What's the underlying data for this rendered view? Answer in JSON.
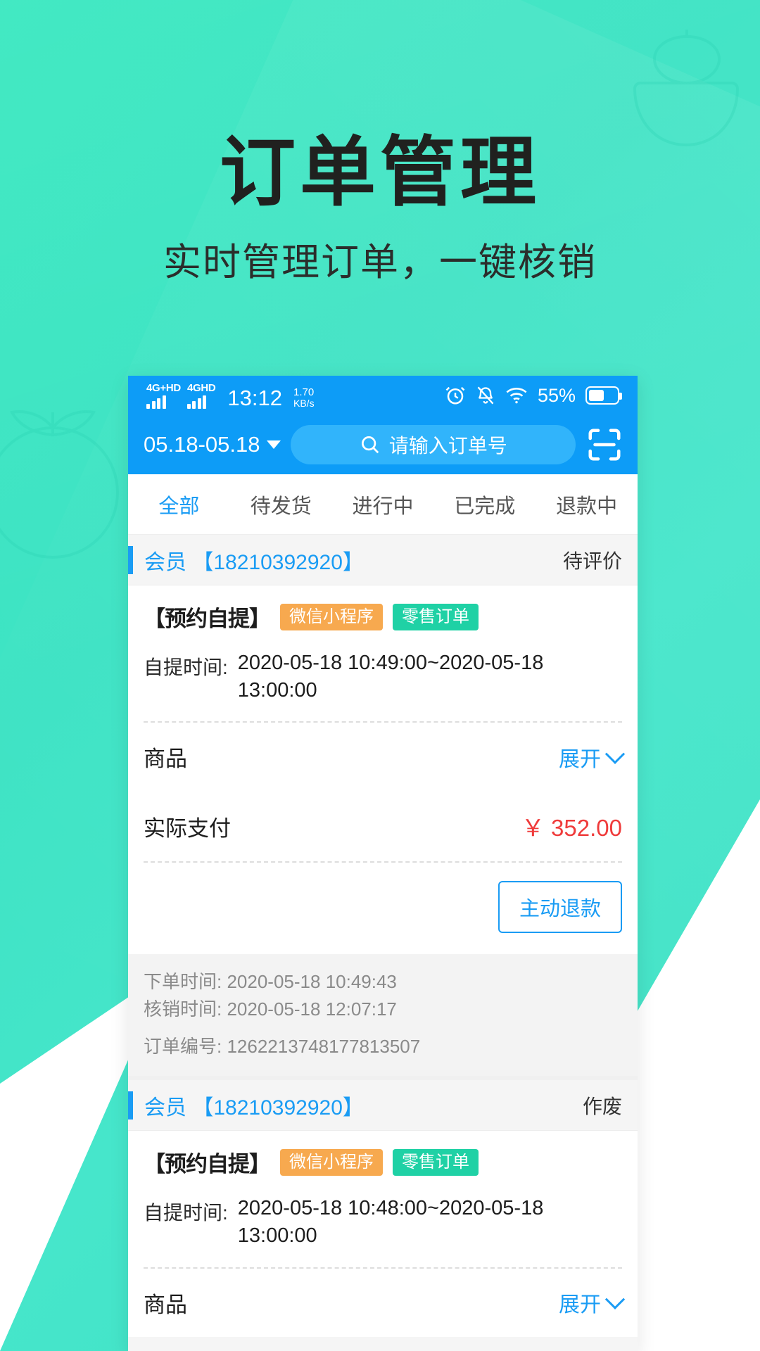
{
  "promo": {
    "title": "订单管理",
    "subtitle": "实时管理订单，一键核销",
    "bg_color": "#3ee3c4",
    "title_color": "#20211f"
  },
  "statusbar": {
    "network_1": "4G+HD",
    "network_2": "4GHD",
    "time": "13:12",
    "netspeed_value": "1.70",
    "netspeed_unit": "KB/s",
    "battery_percent": "55%",
    "icons": [
      "alarm-icon",
      "bell-off-icon",
      "wifi-icon",
      "battery-icon"
    ],
    "bg_color": "#0d9cf7"
  },
  "header": {
    "date_range": "05.18-05.18",
    "search_placeholder": "请输入订单号",
    "search_icon": "search-icon",
    "dropdown_icon": "chevron-down-icon",
    "scan_icon": "scan-barcode-icon",
    "bg_color": "#0d9cf7"
  },
  "tabs": [
    {
      "label": "全部",
      "active": true
    },
    {
      "label": "待发货",
      "active": false
    },
    {
      "label": "进行中",
      "active": false
    },
    {
      "label": "已完成",
      "active": false
    },
    {
      "label": "退款中",
      "active": false
    }
  ],
  "labels": {
    "pickup_time": "自提时间:",
    "goods": "商品",
    "expand": "展开",
    "actual_payment": "实际支付",
    "refund_button": "主动退款",
    "order_time_prefix": "下单时间:",
    "verify_time_prefix": "核销时间:",
    "order_no_prefix": "订单编号:"
  },
  "orders": [
    {
      "member_label": "会员",
      "member_phone": "【18210392920】",
      "status": "待评价",
      "order_type": "【预约自提】",
      "badges": [
        {
          "text": "微信小程序",
          "color": "#f7a94f"
        },
        {
          "text": "零售订单",
          "color": "#1fd1a5"
        }
      ],
      "pickup_time": "2020-05-18 10:49:00~2020-05-18 13:00:00",
      "amount": "￥ 352.00",
      "order_time": "2020-05-18 10:49:43",
      "verify_time": "2020-05-18 12:07:17",
      "order_no": "1262213748177813507"
    },
    {
      "member_label": "会员",
      "member_phone": "【18210392920】",
      "status": "作废",
      "order_type": "【预约自提】",
      "badges": [
        {
          "text": "微信小程序",
          "color": "#f7a94f"
        },
        {
          "text": "零售订单",
          "color": "#1fd1a5"
        }
      ],
      "pickup_time": "2020-05-18 10:48:00~2020-05-18 13:00:00",
      "amount": "",
      "order_time": "",
      "verify_time": "",
      "order_no": ""
    }
  ]
}
